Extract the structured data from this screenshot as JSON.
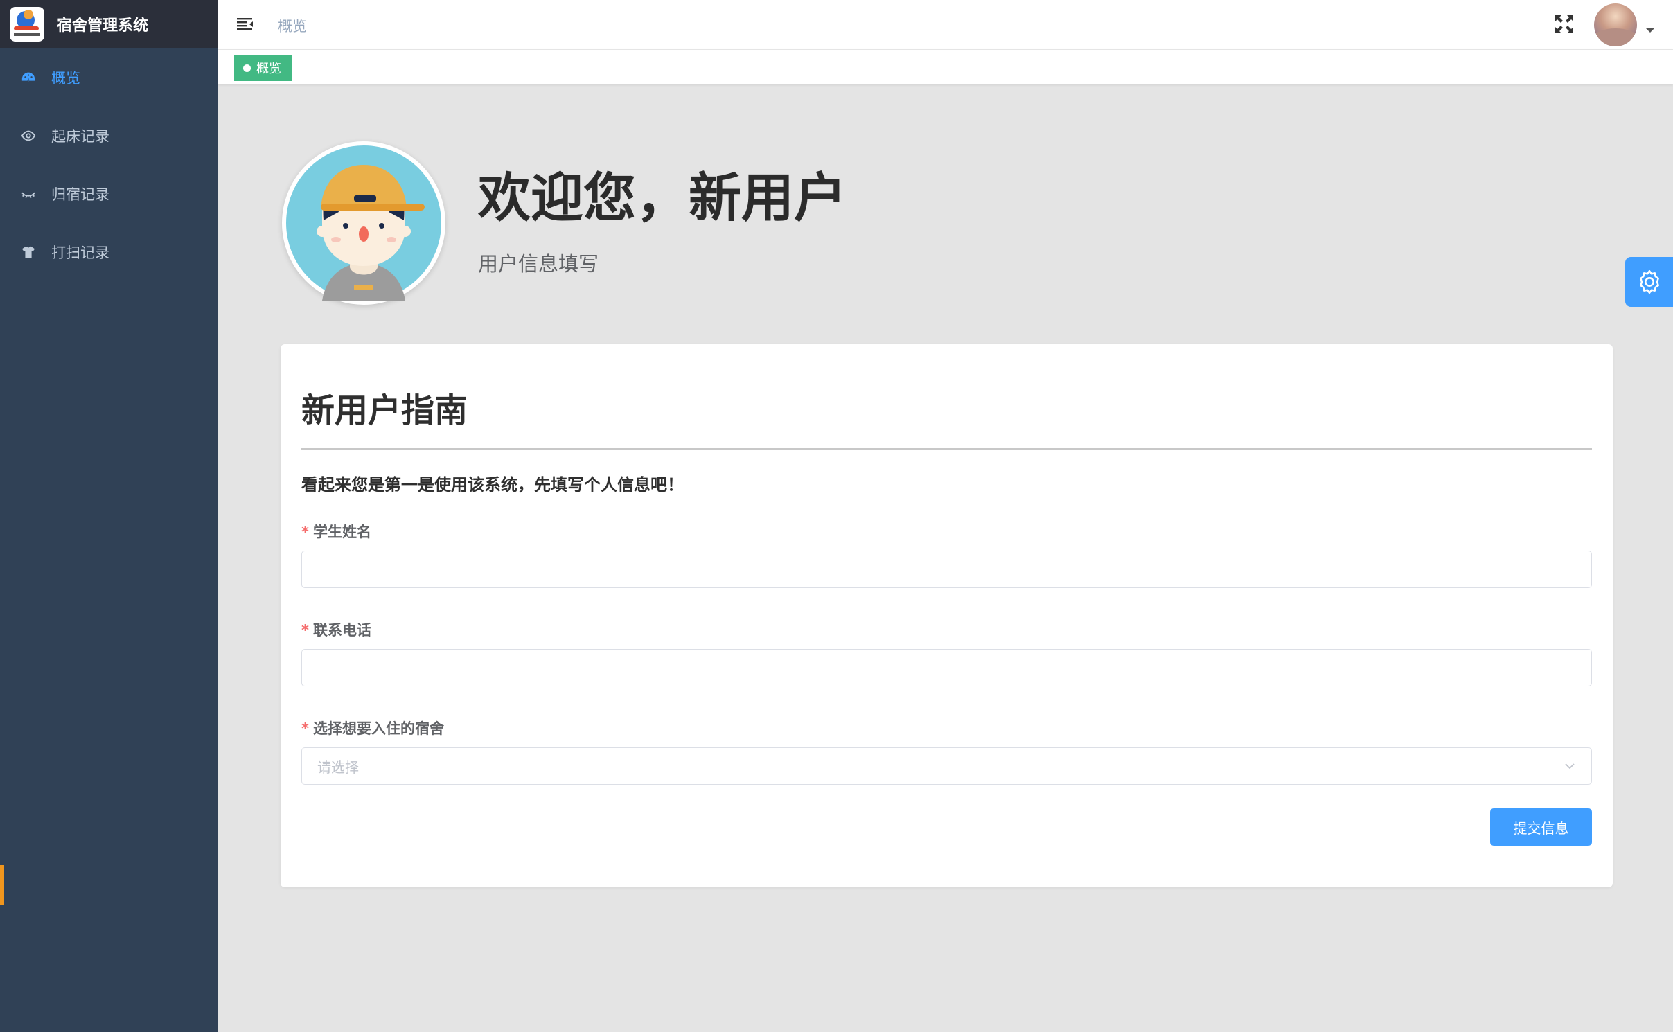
{
  "app": {
    "title": "宿舍管理系统"
  },
  "sidebar": {
    "items": [
      {
        "label": "概览",
        "icon": "dashboard-icon",
        "active": true
      },
      {
        "label": "起床记录",
        "icon": "eye-icon",
        "active": false
      },
      {
        "label": "归宿记录",
        "icon": "eye-closed-icon",
        "active": false
      },
      {
        "label": "打扫记录",
        "icon": "shirt-icon",
        "active": false
      }
    ]
  },
  "navbar": {
    "breadcrumb": "概览",
    "icons": [
      "hamburger-icon",
      "fullscreen-icon",
      "user-avatar",
      "caret-down-icon"
    ]
  },
  "tags": {
    "active": "概览"
  },
  "welcome": {
    "title": "欢迎您，新用户",
    "subtitle": "用户信息填写"
  },
  "card": {
    "title": "新用户指南",
    "description": "看起来您是第一是使用该系统，先填写个人信息吧！",
    "fields": [
      {
        "required_mark": "*",
        "label": "学生姓名",
        "value": "",
        "placeholder": ""
      },
      {
        "required_mark": "*",
        "label": "联系电话",
        "value": "",
        "placeholder": ""
      },
      {
        "required_mark": "*",
        "label": "选择想要入住的宿舍",
        "value": "",
        "placeholder": "请选择"
      }
    ],
    "submit_label": "提交信息"
  },
  "colors": {
    "sidebar_bg": "#304156",
    "accent": "#409eff",
    "tag_green": "#42b983",
    "required": "#f56c6c"
  }
}
